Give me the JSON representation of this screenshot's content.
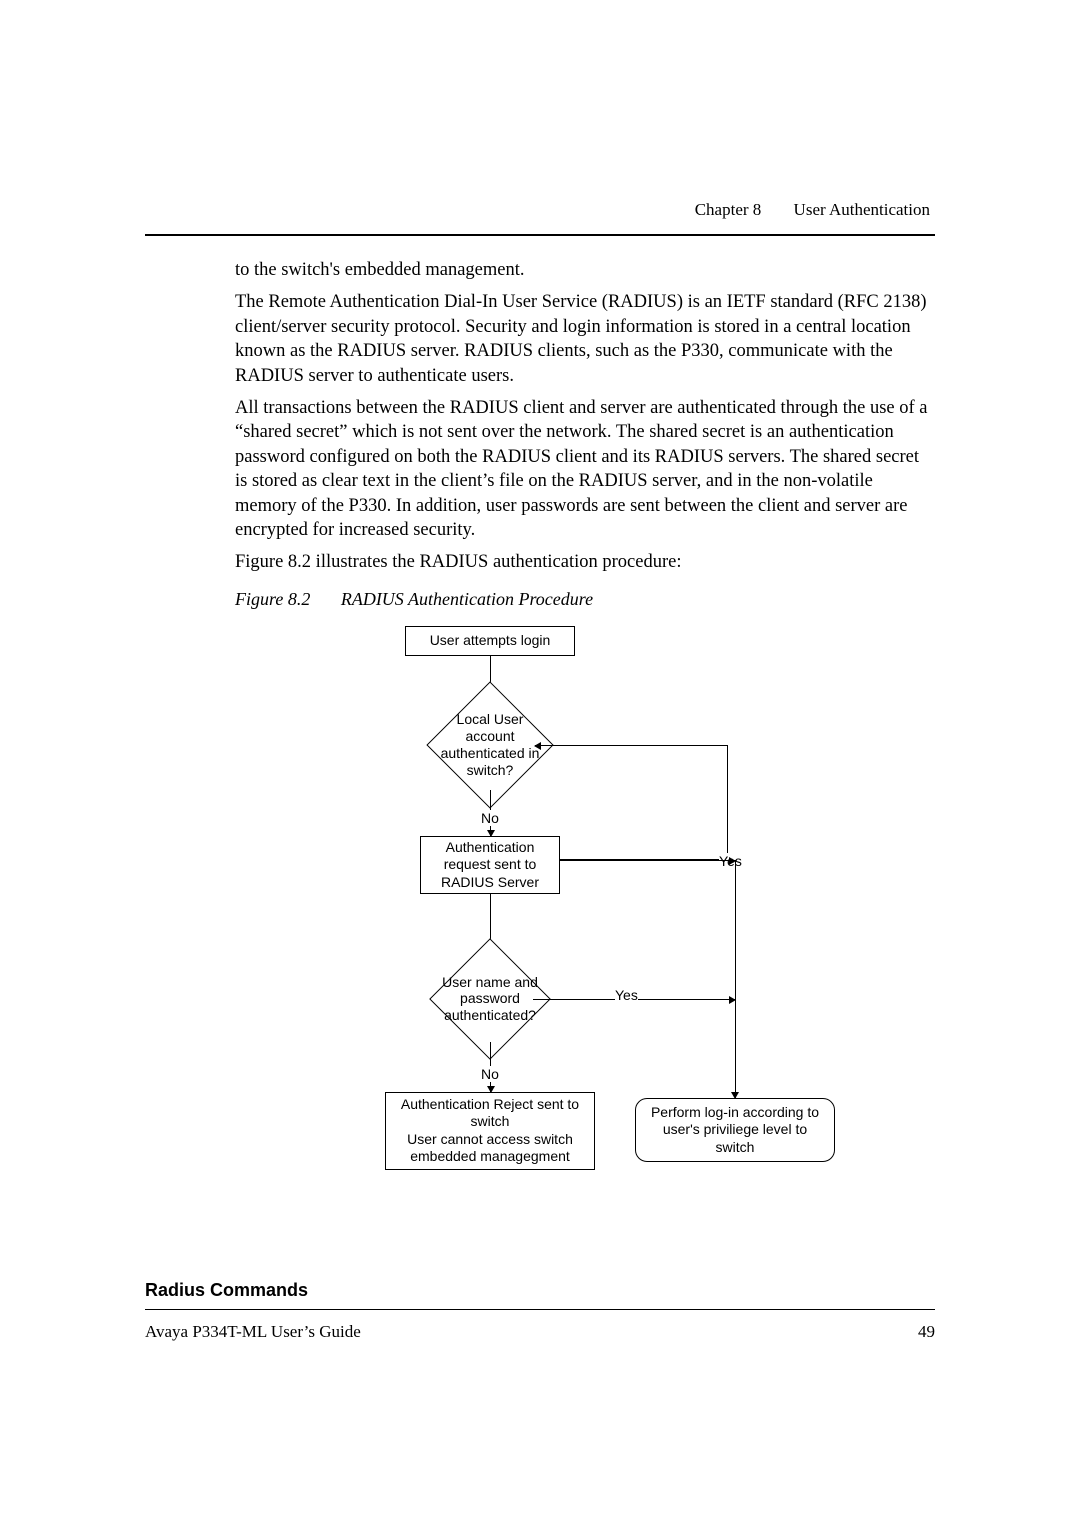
{
  "header": {
    "chapter": "Chapter 8",
    "title": "User Authentication"
  },
  "body": {
    "p1": "to the switch's embedded management.",
    "p2": "The Remote Authentication Dial-In User Service (RADIUS) is an IETF standard (RFC 2138) client/server security protocol. Security and login information is stored in a central location known as the RADIUS server. RADIUS clients, such as the P330, communicate with the RADIUS server to authenticate users.",
    "p3": "All transactions between the RADIUS client and server are authenticated through the use of a “shared secret” which is not sent over the network. The shared secret is an authentication password configured on both the RADIUS client and its RADIUS servers. The shared secret is stored as clear text in the client’s file on the RADIUS server, and in the non-volatile memory of the P330. In addition, user passwords are sent between the client and server are encrypted for increased security.",
    "p4": "Figure 8.2 illustrates the RADIUS authentication procedure:"
  },
  "figure": {
    "number": "Figure 8.2",
    "caption": "RADIUS Authentication Procedure"
  },
  "flow": {
    "start": "User attempts login",
    "decision1": "Local User account authenticated in switch?",
    "no1": "No",
    "process1": "Authentication request sent to RADIUS Server",
    "yes1": "Yes",
    "decision2": "User name and password authenticated?",
    "yes2": "Yes",
    "no2": "No",
    "reject": "Authentication Reject sent to switch\nUser cannot access switch embedded managegment",
    "accept": "Perform log-in according to user's priviliege level to switch"
  },
  "section_heading": "Radius Commands",
  "footer": {
    "left": "Avaya P334T-ML User’s Guide",
    "right": "49"
  }
}
